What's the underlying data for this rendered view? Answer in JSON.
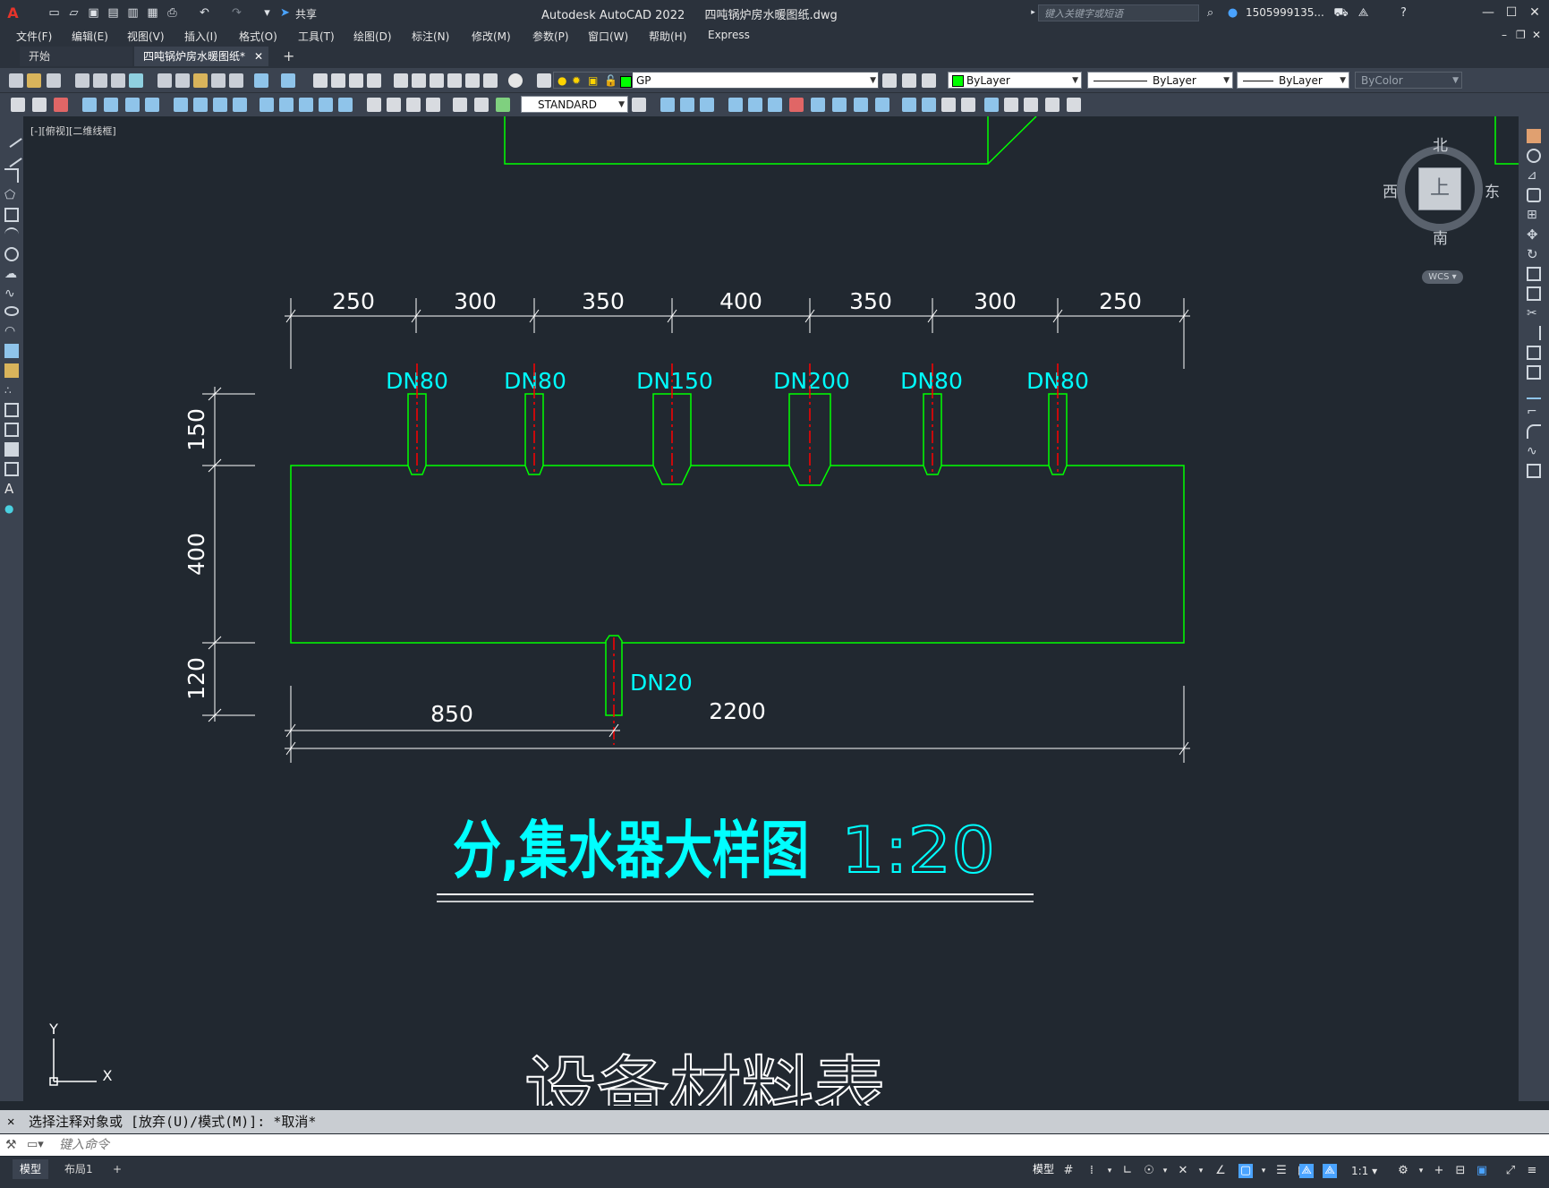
{
  "titlebar": {
    "app_title": "Autodesk AutoCAD 2022",
    "file_name": "四吨锅炉房水暖图纸.dwg",
    "share_label": "共享",
    "search_placeholder": "键入关键字或短语",
    "user_name": "1505999135..."
  },
  "menu": [
    "文件(F)",
    "编辑(E)",
    "视图(V)",
    "插入(I)",
    "格式(O)",
    "工具(T)",
    "绘图(D)",
    "标注(N)",
    "修改(M)",
    "参数(P)",
    "窗口(W)",
    "帮助(H)",
    "Express"
  ],
  "tabs": {
    "start": "开始",
    "active": "四吨锅炉房水暖图纸*",
    "close": "✕",
    "add": "+"
  },
  "toolbar": {
    "layer": "GP",
    "color": "ByLayer",
    "linetype": "ByLayer",
    "lineweight": "ByLayer",
    "plotstyle": "ByColor",
    "textstyle": "STANDARD"
  },
  "viewport_label": "[-][俯视][二维线框]",
  "viewcube": {
    "north": "北",
    "south": "南",
    "west": "西",
    "east": "东",
    "top": "上",
    "wcs": "WCS"
  },
  "ucs": {
    "x": "X",
    "y": "Y"
  },
  "drawing": {
    "top_dims": [
      "250",
      "300",
      "350",
      "400",
      "350",
      "300",
      "250"
    ],
    "pipes": [
      "DN80",
      "DN80",
      "DN150",
      "DN200",
      "DN80",
      "DN80"
    ],
    "left_dims": [
      "150",
      "400",
      "120"
    ],
    "bottom_pipe": "DN20",
    "dim_850": "850",
    "dim_2200": "2200",
    "title_text": "分,集水器大样图",
    "scale_text": "1:20",
    "next_title": "设备材料表"
  },
  "colors": {
    "green": "#00ff00",
    "cyan": "#00ffff",
    "red": "#ff0000",
    "white": "#ffffff",
    "background": "#212830"
  },
  "command": {
    "history": "选择注释对象或 [放弃(U)/模式(M)]: *取消*",
    "placeholder": "键入命令"
  },
  "status": {
    "model_tab": "模型",
    "layout_tab": "布局1",
    "add": "+",
    "model_btn": "模型",
    "scale": "1:1"
  }
}
